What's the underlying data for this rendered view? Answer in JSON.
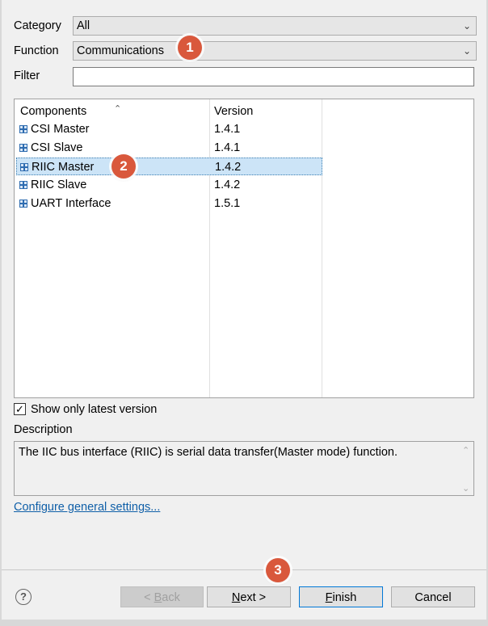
{
  "filters": {
    "category_label": "Category",
    "category_value": "All",
    "function_label": "Function",
    "function_value": "Communications",
    "filter_label": "Filter",
    "filter_value": ""
  },
  "table": {
    "col_components": "Components",
    "col_version": "Version",
    "rows": [
      {
        "name": "CSI Master",
        "version": "1.4.1"
      },
      {
        "name": "CSI Slave",
        "version": "1.4.1"
      },
      {
        "name": "RIIC Master",
        "version": "1.4.2"
      },
      {
        "name": "RIIC Slave",
        "version": "1.4.2"
      },
      {
        "name": "UART Interface",
        "version": "1.5.1"
      }
    ],
    "selected_index": 2
  },
  "show_latest": {
    "label": "Show only latest version",
    "checked": true
  },
  "description": {
    "label": "Description",
    "text": "The IIC bus interface (RIIC) is serial data transfer(Master mode) function."
  },
  "link_text": "Configure general settings...",
  "buttons": {
    "back_prefix": "< ",
    "back_mnemonic": "B",
    "back_rest": "ack",
    "next_mnemonic": "N",
    "next_rest": "ext >",
    "finish_mnemonic": "F",
    "finish_rest": "inish",
    "cancel": "Cancel"
  },
  "badges": [
    "1",
    "2",
    "3"
  ],
  "icons": {
    "component": "plus-square-icon",
    "help": "help-icon",
    "dropdown": "chevron-down-icon",
    "check": "checkmark-icon"
  },
  "colors": {
    "badge": "#d9583c",
    "selection": "#cce4f7",
    "link": "#0f5fa8",
    "default_button_border": "#0078d7"
  }
}
